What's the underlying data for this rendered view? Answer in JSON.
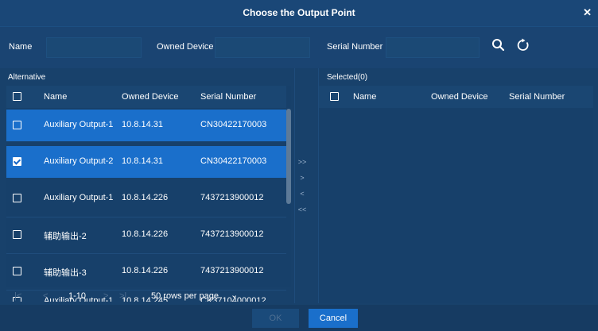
{
  "dialog": {
    "title": "Choose the Output Point"
  },
  "filters": {
    "name_label": "Name",
    "owned_device_label": "Owned Device",
    "serial_label": "Serial Number",
    "name_value": "",
    "owned_device_value": "",
    "serial_value": ""
  },
  "alternative": {
    "label": "Alternative",
    "columns": [
      "Name",
      "Owned Device",
      "Serial Number"
    ],
    "rows": [
      {
        "name": "Auxiliary Output-1",
        "device": "10.8.14.31",
        "serial": "CN30422170003",
        "checked": false,
        "highlighted": true
      },
      {
        "name": "Auxiliary Output-2",
        "device": "10.8.14.31",
        "serial": "CN30422170003",
        "checked": true,
        "highlighted": true
      },
      {
        "name": "Auxiliary Output-1",
        "device": "10.8.14.226",
        "serial": "7437213900012",
        "checked": false,
        "highlighted": false
      },
      {
        "name": "辅助输出-2",
        "device": "10.8.14.226",
        "serial": "7437213900012",
        "checked": false,
        "highlighted": false
      },
      {
        "name": "辅助输出-3",
        "device": "10.8.14.226",
        "serial": "7437213900012",
        "checked": false,
        "highlighted": false
      },
      {
        "name": "Auxiliary Output-1",
        "device": "10.8.14.245",
        "serial": "CK37104000012",
        "checked": false,
        "highlighted": false
      }
    ]
  },
  "selected": {
    "label": "Selected(0)",
    "columns": [
      "Name",
      "Owned Device",
      "Serial Number"
    ]
  },
  "transfer": [
    ">>",
    ">",
    "<",
    "<<"
  ],
  "pager": {
    "first": "|<",
    "prev": "<",
    "range": "1-10",
    "next": ">",
    "last": ">|",
    "rows_per_page": "50 rows per page",
    "caret": "⌄"
  },
  "footer": {
    "ok": "OK",
    "cancel": "Cancel"
  },
  "colors": {
    "accent": "#1a6fcb",
    "dialog_bg": "#17406a"
  }
}
